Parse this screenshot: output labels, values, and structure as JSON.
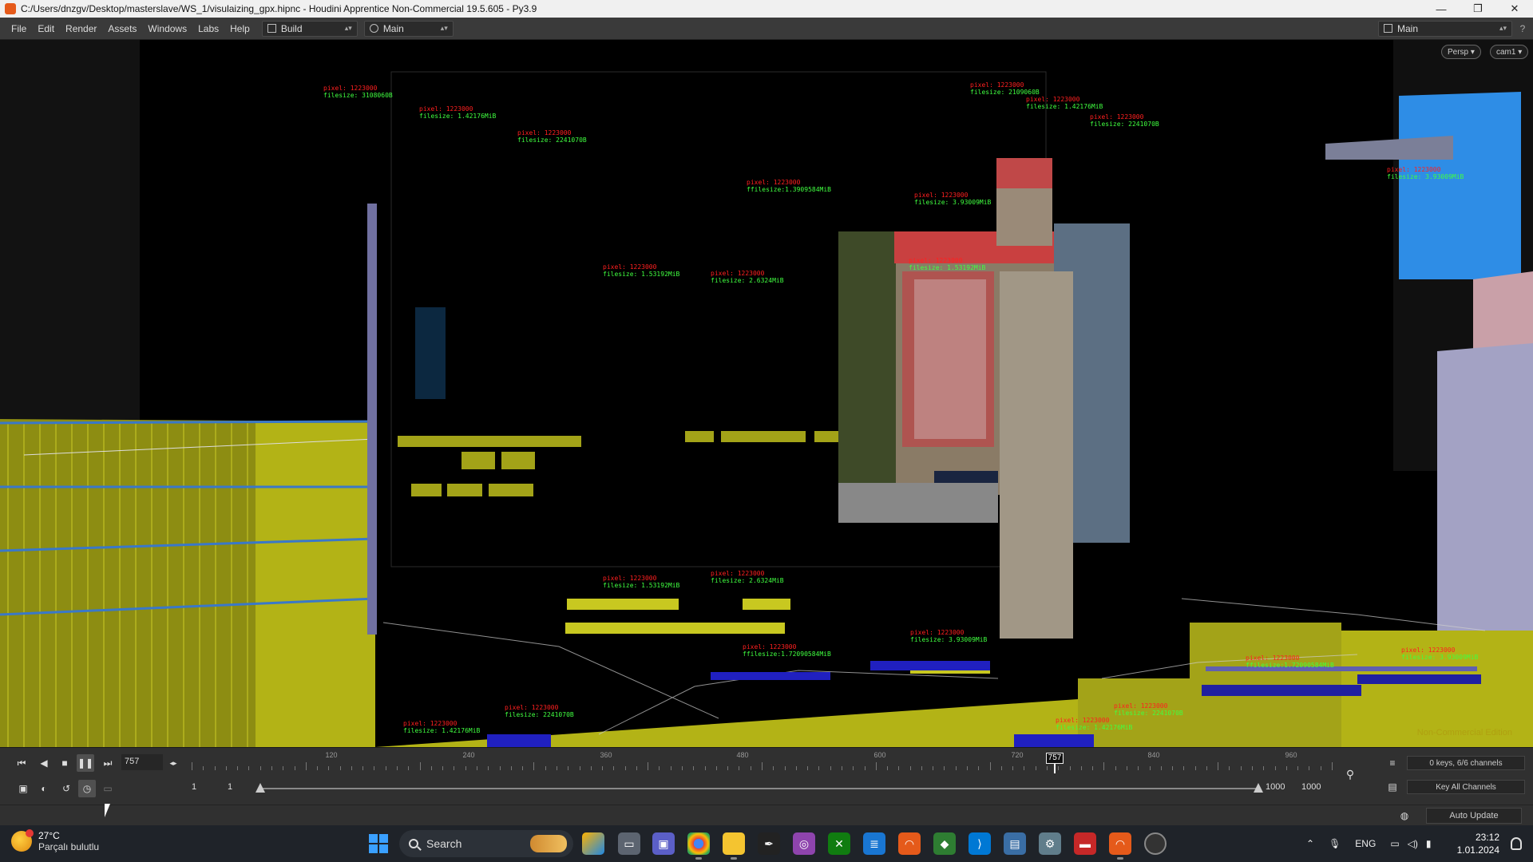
{
  "window": {
    "title": "C:/Users/dnzgv/Desktop/masterslave/WS_1/visulaizing_gpx.hipnc - Houdini Apprentice Non-Commercial 19.5.605 - Py3.9",
    "minimize": "—",
    "maximize": "❐",
    "close": "✕"
  },
  "menubar": {
    "items": [
      "File",
      "Edit",
      "Render",
      "Assets",
      "Windows",
      "Labs",
      "Help"
    ],
    "desktop_label": "Build",
    "network_label": "Main",
    "right_label": "Main"
  },
  "viewport": {
    "camera_view": "Persp ▾",
    "camera_name": "cam1 ▾",
    "watermark": "Non-Commercial Edition",
    "labels": [
      {
        "red": "pixel: 1223000",
        "green": "filesize: 3108060B"
      },
      {
        "red": "pixel: 1223000",
        "green": "filesize: 1.42176MiB"
      },
      {
        "red": "pixel: 1223000",
        "green": "filesize: 2241070B"
      },
      {
        "red": "pixel: 1223000",
        "green": "filesize: 2109060B"
      },
      {
        "red": "pixel: 1223000",
        "green": "filesize: 1.42176MiB"
      },
      {
        "red": "pixel: 1223000",
        "green": "filesize: 2241070B"
      },
      {
        "red": "pixel: 1223000",
        "green": "filesize: 3.93009MiB"
      },
      {
        "red": "pixel: 1223000",
        "green": "filesize: 1.53192MiB"
      },
      {
        "red": "pixel: 1223000",
        "green": "filesize: 2.6324MiB"
      },
      {
        "red": "pixel: 1223000",
        "green": "ffilesize:1.3909584MiB"
      },
      {
        "red": "pixel: 1223000",
        "green": "filesize: 1.53192MiB"
      },
      {
        "red": "pixel: 1223000",
        "green": "filesize: 1.53192MiB"
      },
      {
        "red": "pixel: 1223000",
        "green": "filesize: 2.6324MiB"
      },
      {
        "red": "pixel: 1223000",
        "green": "filesize: 3.93009MiB"
      },
      {
        "red": "pixel: 1223000",
        "green": "ffilesize:1.72090584MiB"
      },
      {
        "red": "pixel: 1223000",
        "green": "filesize: 1.42176MiB"
      },
      {
        "red": "pixel: 1223000",
        "green": "filesize: 2241070B"
      },
      {
        "red": "pixel: 1223000",
        "green": "filesize: 1.42176MiB"
      },
      {
        "red": "pixel: 1223000",
        "green": "filesize: 2241070B"
      },
      {
        "red": "pixel: 1223000",
        "green": "ffilesize:1.72090584MiB"
      },
      {
        "red": "pixel: 1223000",
        "green": "filesize: 3.93009MiB"
      },
      {
        "red": "pixel: 1223000",
        "green": "filesize: 3.93009MiB"
      }
    ]
  },
  "playbar": {
    "current_frame": "757",
    "marker_frame": "757",
    "tick_labels": [
      "120",
      "240",
      "360",
      "480",
      "600",
      "720",
      "840",
      "960"
    ],
    "range_start": "1",
    "range_start2": "1",
    "range_end": "1000",
    "range_end2": "1000",
    "keys_info": "0 keys, 6/6 channels",
    "key_all": "Key All Channels",
    "auto_update": "Auto Update",
    "progress": 0.757
  },
  "taskbar": {
    "temperature": "27°C",
    "condition": "Parçalı bulutlu",
    "search": "Search",
    "language": "ENG",
    "time": "23:12",
    "date": "1.01.2024"
  },
  "colors": {
    "viewport_bg": "#000000",
    "grid_yellow": "#b5b519",
    "grid_blue": "#3a78c8",
    "label_red": "#ff2020",
    "label_green": "#40ff40",
    "houdini_orange": "#e55a1a"
  }
}
